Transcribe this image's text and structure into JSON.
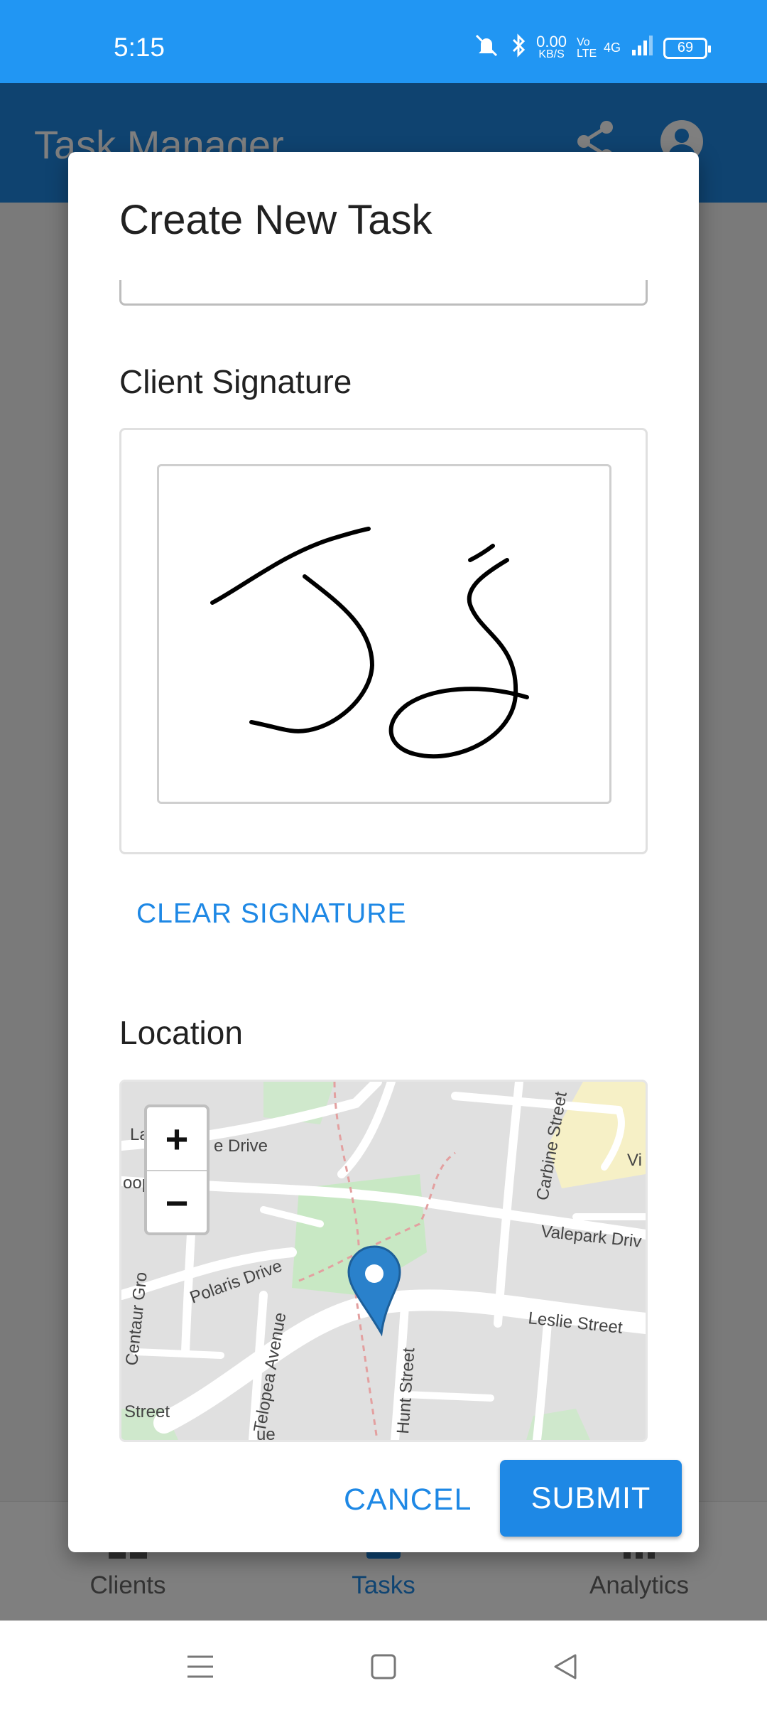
{
  "status_bar": {
    "time": "5:15",
    "net_speed": "0.00",
    "net_unit": "KB/S",
    "volte": "Vo LTE",
    "network": "4G",
    "battery": "69"
  },
  "app_bar": {
    "title": "Task Manager"
  },
  "bottom_nav": {
    "items": [
      {
        "label": "Clients",
        "icon": "clients-icon"
      },
      {
        "label": "Tasks",
        "icon": "tasks-icon"
      },
      {
        "label": "Analytics",
        "icon": "analytics-icon"
      }
    ],
    "active_index": 1
  },
  "dialog": {
    "title": "Create New Task",
    "signature_label": "Client Signature",
    "clear_signature": "CLEAR SIGNATURE",
    "location_label": "Location",
    "map": {
      "zoom_in": "+",
      "zoom_out": "−",
      "streets": [
        "e Drive",
        "Carbine Street",
        "Valepark Driv",
        "Leslie Street",
        "Polaris Drive",
        "Centaur Gro",
        "Telopea Avenue",
        "Hunt Street",
        "Street",
        "La",
        "oop",
        "Vi",
        "ue"
      ]
    },
    "cancel": "CANCEL",
    "submit": "SUBMIT"
  },
  "colors": {
    "primary": "#2196F3",
    "app_bar": "#1F87E1",
    "accent": "#1E88E5"
  }
}
